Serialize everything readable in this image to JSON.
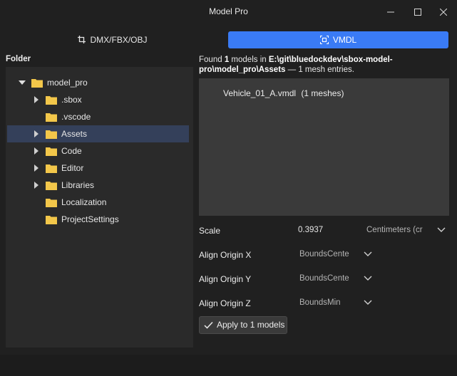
{
  "window": {
    "title": "Model Pro"
  },
  "modes": [
    {
      "label": "DMX/FBX/OBJ",
      "icon": "crop-icon",
      "active": false
    },
    {
      "label": "VMDL",
      "icon": "model-icon",
      "active": true
    }
  ],
  "accent_color": "#3a7bf5",
  "folder_panel": {
    "label": "Folder",
    "tree": [
      {
        "label": "model_pro",
        "expanded": true,
        "has_children": true,
        "selected": false
      },
      {
        "label": ".sbox",
        "has_children": true,
        "selected": false
      },
      {
        "label": ".vscode",
        "has_children": false,
        "selected": false
      },
      {
        "label": "Assets",
        "has_children": true,
        "selected": true
      },
      {
        "label": "Code",
        "has_children": true,
        "selected": false
      },
      {
        "label": "Editor",
        "has_children": true,
        "selected": false
      },
      {
        "label": "Libraries",
        "has_children": true,
        "selected": false
      },
      {
        "label": "Localization",
        "has_children": false,
        "selected": false
      },
      {
        "label": "ProjectSettings",
        "has_children": false,
        "selected": false
      }
    ]
  },
  "found": {
    "prefix": "Found",
    "count": "1",
    "middle": "models in",
    "path": "E:\\git\\bluedockdev\\sbox-model-pro\\model_pro\\Assets",
    "suffix": "— 1 mesh entries."
  },
  "models": [
    {
      "name": "Vehicle_01_A.vmdl",
      "meshes": "(1 meshes)"
    }
  ],
  "properties": {
    "scale": {
      "label": "Scale",
      "value": "0.3937",
      "unit": "Centimeters (cr"
    },
    "align_x": {
      "label": "Align Origin X",
      "value": "BoundsCente"
    },
    "align_y": {
      "label": "Align Origin Y",
      "value": "BoundsCente"
    },
    "align_z": {
      "label": "Align Origin Z",
      "value": "BoundsMin"
    }
  },
  "apply_button": {
    "label": "Apply to 1 models"
  }
}
